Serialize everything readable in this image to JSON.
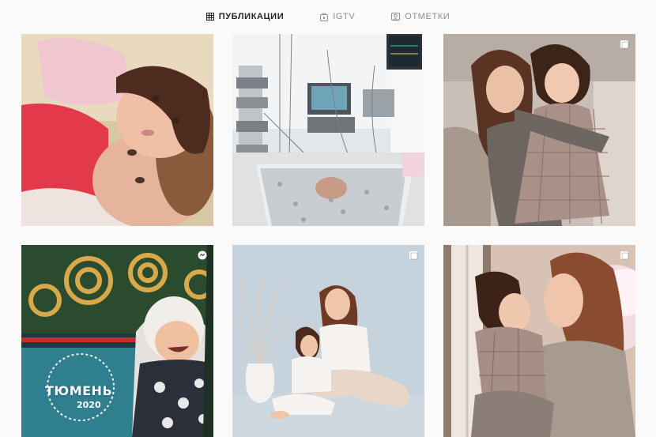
{
  "tabs": [
    {
      "label": "ПУБЛИКАЦИИ",
      "icon": "grid-icon",
      "active": true
    },
    {
      "label": "IGTV",
      "icon": "igtv-icon",
      "active": false
    },
    {
      "label": "ОТМЕТКИ",
      "icon": "tagged-icon",
      "active": false
    }
  ],
  "posts": [
    {
      "badge": null
    },
    {
      "badge": null
    },
    {
      "badge": "carousel-icon"
    },
    {
      "badge": "clip-icon",
      "overlay_text": "ТЮМЕНЬ",
      "overlay_year": "2020"
    },
    {
      "badge": "carousel-icon"
    },
    {
      "badge": "carousel-icon"
    }
  ],
  "colors": {
    "background": "#fafafa",
    "tab_active": "#262626",
    "tab_inactive": "#8e8e8e"
  }
}
